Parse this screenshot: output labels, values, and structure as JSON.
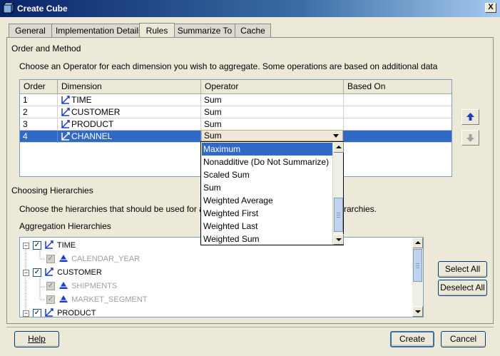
{
  "window": {
    "title": "Create Cube",
    "close_label": "X"
  },
  "tabs": [
    {
      "label": "General"
    },
    {
      "label": "Implementation Details"
    },
    {
      "label": "Rules"
    },
    {
      "label": "Summarize To"
    },
    {
      "label": "Cache"
    }
  ],
  "order_section": {
    "title": "Order and Method",
    "description": "Choose an Operator for each dimension you wish to aggregate. Some operations are based on additional data"
  },
  "grid": {
    "columns": [
      "Order",
      "Dimension",
      "Operator",
      "Based On"
    ],
    "rows": [
      {
        "order": "1",
        "dimension": "TIME",
        "operator": "Sum",
        "based_on": ""
      },
      {
        "order": "2",
        "dimension": "CUSTOMER",
        "operator": "Sum",
        "based_on": ""
      },
      {
        "order": "3",
        "dimension": "PRODUCT",
        "operator": "Sum",
        "based_on": ""
      },
      {
        "order": "4",
        "dimension": "CHANNEL",
        "operator": "Sum",
        "based_on": ""
      }
    ],
    "selected_row": 3
  },
  "operator_dropdown": {
    "selected": "Sum",
    "highlighted": "Maximum",
    "options": [
      "Maximum",
      "Nonadditive (Do Not Summarize)",
      "Scaled Sum",
      "Sum",
      "Weighted Average",
      "Weighted First",
      "Weighted Last",
      "Weighted Sum"
    ]
  },
  "hierarchy_section": {
    "title": "Choosing Hierarchies",
    "description_left": "Choose the hierarchies that should be used for aggre",
    "description_right": "rarchies.",
    "list_label": "Aggregation Hierarchies"
  },
  "tree": [
    {
      "label": "TIME",
      "level": 0,
      "kind": "dimension",
      "enabled": true
    },
    {
      "label": "CALENDAR_YEAR",
      "level": 1,
      "kind": "hierarchy",
      "enabled": false
    },
    {
      "label": "CUSTOMER",
      "level": 0,
      "kind": "dimension",
      "enabled": true
    },
    {
      "label": "SHIPMENTS",
      "level": 1,
      "kind": "hierarchy",
      "enabled": false
    },
    {
      "label": "MARKET_SEGMENT",
      "level": 1,
      "kind": "hierarchy",
      "enabled": false
    },
    {
      "label": "PRODUCT",
      "level": 0,
      "kind": "dimension",
      "enabled": true
    }
  ],
  "buttons": {
    "select_all": "Select All",
    "deselect_all": "Deselect All",
    "help": "Help",
    "create": "Create",
    "cancel": "Cancel"
  },
  "colors": {
    "selection": "#316ac5",
    "title_gradient_start": "#0a246a",
    "dialog_bg": "#ece9d8"
  }
}
